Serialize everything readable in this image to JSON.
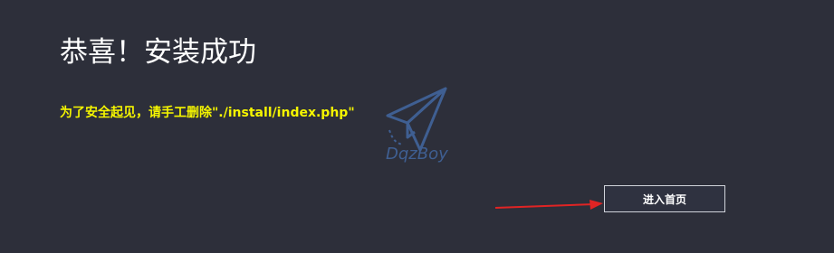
{
  "page": {
    "title": "恭喜！安装成功",
    "notice": "为了安全起见，请手工删除\"./install/index.php\""
  },
  "watermark": {
    "icon": "paper-plane-icon",
    "text": "DqzBoy",
    "color": "#3f5f92"
  },
  "actions": {
    "enter_home_label": "进入首页"
  },
  "annotation": {
    "icon": "red-arrow-icon",
    "color": "#e02424"
  },
  "colors": {
    "background": "#2d2f3a",
    "title": "#ffffff",
    "notice": "#f5f500",
    "button_border": "#d0d3da"
  }
}
